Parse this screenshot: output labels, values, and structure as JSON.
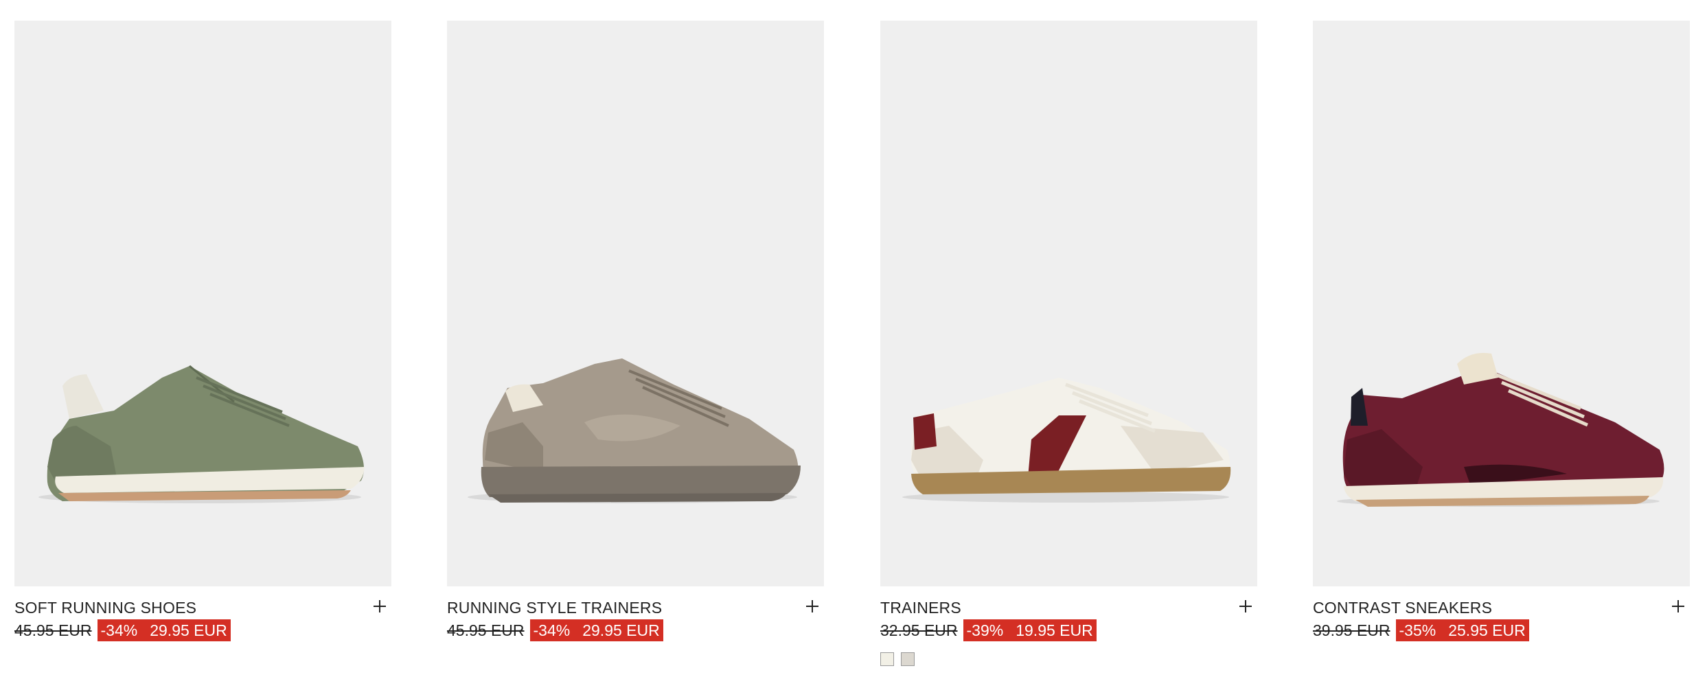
{
  "products": [
    {
      "name": "SOFT RUNNING SHOES",
      "old_price": "45.95 EUR",
      "discount": "-34%",
      "new_price": "29.95 EUR",
      "colors": {
        "upper": "#7d8a6c",
        "suede": "#6f7b60",
        "sole": "#f0ede2",
        "accent": "#e9e6dc",
        "outsole": "#c99c77"
      }
    },
    {
      "name": "RUNNING STYLE TRAINERS",
      "old_price": "45.95 EUR",
      "discount": "-34%",
      "new_price": "29.95 EUR",
      "colors": {
        "upper": "#a59a8c",
        "suede": "#8f8577",
        "sole": "#7c746a",
        "accent": "#ece6d8",
        "outsole": "#6b645c"
      }
    },
    {
      "name": "TRAINERS",
      "old_price": "32.95 EUR",
      "discount": "-39%",
      "new_price": "19.95 EUR",
      "colors": {
        "upper": "#f3f1ea",
        "suede": "#e4ded2",
        "sole": "#f0ede2",
        "accent": "#7a1f24",
        "outsole": "#a88754"
      },
      "swatches": [
        "#f2f0e6",
        "#dcd8d0"
      ]
    },
    {
      "name": "CONTRAST SNEAKERS",
      "old_price": "39.95 EUR",
      "discount": "-35%",
      "new_price": "25.95 EUR",
      "colors": {
        "upper": "#6e1e30",
        "suede": "#5a1827",
        "sole": "#efe9dc",
        "accent": "#ece3cf",
        "outsole": "#c7a07a"
      }
    }
  ],
  "theme": {
    "sale_badge": "#d42f24",
    "image_bg": "#efefef"
  }
}
